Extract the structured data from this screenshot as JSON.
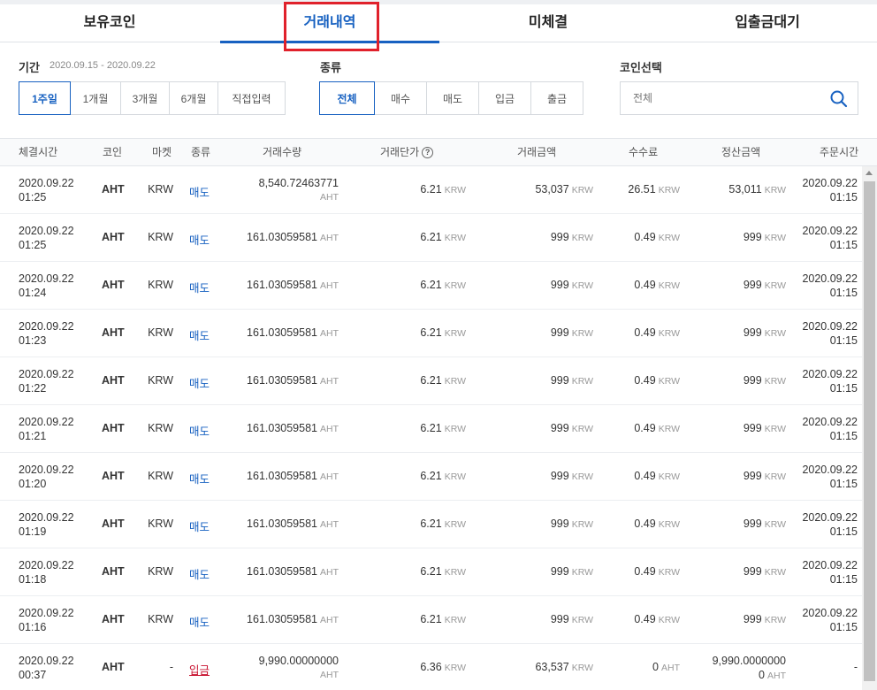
{
  "tabs": [
    "보유코인",
    "거래내역",
    "미체결",
    "입출금대기"
  ],
  "active_tab": 1,
  "filters": {
    "period_label": "기간",
    "period_range": "2020.09.15 - 2020.09.22",
    "period_options": [
      "1주일",
      "1개월",
      "3개월",
      "6개월",
      "직접입력"
    ],
    "type_label": "종류",
    "type_options": [
      "전체",
      "매수",
      "매도",
      "입금",
      "출금"
    ],
    "coin_label": "코인선택",
    "coin_placeholder": "전체"
  },
  "columns": [
    "체결시간",
    "코인",
    "마켓",
    "종류",
    "거래수량",
    "거래단가",
    "거래금액",
    "수수료",
    "정산금액",
    "주문시간"
  ],
  "help_glyph": "?",
  "rows": [
    {
      "date": "2020.09.22",
      "time": "01:25",
      "coin": "AHT",
      "market": "KRW",
      "type": "매도",
      "qty": "8,540.72463771",
      "qty_unit": "AHT",
      "price": "6.21",
      "price_unit": "KRW",
      "amount": "53,037",
      "amount_unit": "KRW",
      "fee": "26.51",
      "fee_unit": "KRW",
      "settle": "53,011",
      "settle_unit": "KRW",
      "order_date": "2020.09.22",
      "order_time": "01:15"
    },
    {
      "date": "2020.09.22",
      "time": "01:25",
      "coin": "AHT",
      "market": "KRW",
      "type": "매도",
      "qty": "161.03059581",
      "qty_unit": "AHT",
      "price": "6.21",
      "price_unit": "KRW",
      "amount": "999",
      "amount_unit": "KRW",
      "fee": "0.49",
      "fee_unit": "KRW",
      "settle": "999",
      "settle_unit": "KRW",
      "order_date": "2020.09.22",
      "order_time": "01:15"
    },
    {
      "date": "2020.09.22",
      "time": "01:24",
      "coin": "AHT",
      "market": "KRW",
      "type": "매도",
      "qty": "161.03059581",
      "qty_unit": "AHT",
      "price": "6.21",
      "price_unit": "KRW",
      "amount": "999",
      "amount_unit": "KRW",
      "fee": "0.49",
      "fee_unit": "KRW",
      "settle": "999",
      "settle_unit": "KRW",
      "order_date": "2020.09.22",
      "order_time": "01:15"
    },
    {
      "date": "2020.09.22",
      "time": "01:23",
      "coin": "AHT",
      "market": "KRW",
      "type": "매도",
      "qty": "161.03059581",
      "qty_unit": "AHT",
      "price": "6.21",
      "price_unit": "KRW",
      "amount": "999",
      "amount_unit": "KRW",
      "fee": "0.49",
      "fee_unit": "KRW",
      "settle": "999",
      "settle_unit": "KRW",
      "order_date": "2020.09.22",
      "order_time": "01:15"
    },
    {
      "date": "2020.09.22",
      "time": "01:22",
      "coin": "AHT",
      "market": "KRW",
      "type": "매도",
      "qty": "161.03059581",
      "qty_unit": "AHT",
      "price": "6.21",
      "price_unit": "KRW",
      "amount": "999",
      "amount_unit": "KRW",
      "fee": "0.49",
      "fee_unit": "KRW",
      "settle": "999",
      "settle_unit": "KRW",
      "order_date": "2020.09.22",
      "order_time": "01:15"
    },
    {
      "date": "2020.09.22",
      "time": "01:21",
      "coin": "AHT",
      "market": "KRW",
      "type": "매도",
      "qty": "161.03059581",
      "qty_unit": "AHT",
      "price": "6.21",
      "price_unit": "KRW",
      "amount": "999",
      "amount_unit": "KRW",
      "fee": "0.49",
      "fee_unit": "KRW",
      "settle": "999",
      "settle_unit": "KRW",
      "order_date": "2020.09.22",
      "order_time": "01:15"
    },
    {
      "date": "2020.09.22",
      "time": "01:20",
      "coin": "AHT",
      "market": "KRW",
      "type": "매도",
      "qty": "161.03059581",
      "qty_unit": "AHT",
      "price": "6.21",
      "price_unit": "KRW",
      "amount": "999",
      "amount_unit": "KRW",
      "fee": "0.49",
      "fee_unit": "KRW",
      "settle": "999",
      "settle_unit": "KRW",
      "order_date": "2020.09.22",
      "order_time": "01:15"
    },
    {
      "date": "2020.09.22",
      "time": "01:19",
      "coin": "AHT",
      "market": "KRW",
      "type": "매도",
      "qty": "161.03059581",
      "qty_unit": "AHT",
      "price": "6.21",
      "price_unit": "KRW",
      "amount": "999",
      "amount_unit": "KRW",
      "fee": "0.49",
      "fee_unit": "KRW",
      "settle": "999",
      "settle_unit": "KRW",
      "order_date": "2020.09.22",
      "order_time": "01:15"
    },
    {
      "date": "2020.09.22",
      "time": "01:18",
      "coin": "AHT",
      "market": "KRW",
      "type": "매도",
      "qty": "161.03059581",
      "qty_unit": "AHT",
      "price": "6.21",
      "price_unit": "KRW",
      "amount": "999",
      "amount_unit": "KRW",
      "fee": "0.49",
      "fee_unit": "KRW",
      "settle": "999",
      "settle_unit": "KRW",
      "order_date": "2020.09.22",
      "order_time": "01:15"
    },
    {
      "date": "2020.09.22",
      "time": "01:16",
      "coin": "AHT",
      "market": "KRW",
      "type": "매도",
      "qty": "161.03059581",
      "qty_unit": "AHT",
      "price": "6.21",
      "price_unit": "KRW",
      "amount": "999",
      "amount_unit": "KRW",
      "fee": "0.49",
      "fee_unit": "KRW",
      "settle": "999",
      "settle_unit": "KRW",
      "order_date": "2020.09.22",
      "order_time": "01:15"
    },
    {
      "date": "2020.09.22",
      "time": "00:37",
      "coin": "AHT",
      "market": "-",
      "type": "입금",
      "qty": "9,990.00000000",
      "qty_unit": "AHT",
      "price": "6.36",
      "price_unit": "KRW",
      "amount": "63,537",
      "amount_unit": "KRW",
      "fee": "0",
      "fee_unit": "AHT",
      "settle": "9,990.0000000",
      "settle_extra": "0",
      "settle_unit": "AHT",
      "order_date": "",
      "order_time": "-"
    }
  ]
}
